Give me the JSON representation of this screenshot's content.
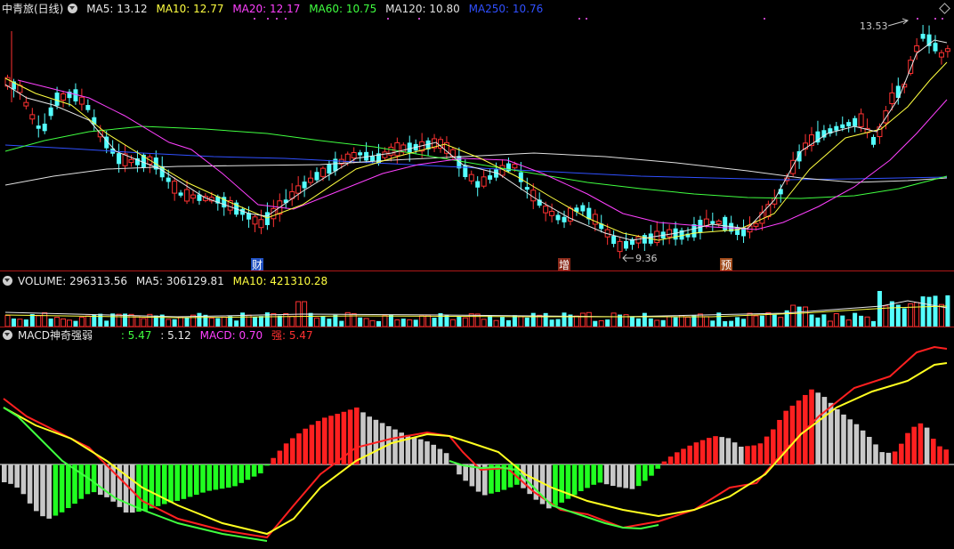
{
  "price_panel": {
    "title": "中青旅(日线)",
    "indicators": [
      {
        "name": "MA5",
        "value": "MA5: 13.12",
        "color": "#e8e8e8"
      },
      {
        "name": "MA10",
        "value": "MA10: 12.77",
        "color": "#ffff40"
      },
      {
        "name": "MA20",
        "value": "MA20: 12.17",
        "color": "#ff40ff"
      },
      {
        "name": "MA60",
        "value": "MA60: 10.75",
        "color": "#40ff40"
      },
      {
        "name": "MA120",
        "value": "MA120: 10.80",
        "color": "#e0e0e0"
      },
      {
        "name": "MA250",
        "value": "MA250: 10.76",
        "color": "#3050ff"
      }
    ],
    "high_label": "13.53",
    "low_label": "9.36",
    "event_markers": [
      {
        "label": "财",
        "color": "#2050c0"
      },
      {
        "label": "增",
        "color": "#8a2a1a"
      },
      {
        "label": "预",
        "color": "#a04a1a"
      }
    ]
  },
  "volume_panel": {
    "title": "VOLUME: 296313.56",
    "ma5": "MA5: 306129.81",
    "ma10": "MA10: 421310.28"
  },
  "macd_panel": {
    "title": "MACD神奇强弱",
    "v1": ": 5.47",
    "v2": ": 5.12",
    "macd": "MACD: 0.70",
    "strong": "强: 5.47"
  },
  "colors": {
    "up": "#ff3232",
    "down": "#54ffff",
    "ma5": "#e8e8e8",
    "ma10": "#ffff40",
    "ma20": "#ff40ff",
    "ma60": "#40ff40",
    "ma120": "#e0e0e0",
    "ma250": "#3050ff",
    "macd_pos": "#ff2020",
    "macd_neg": "#20ff20",
    "macd_fade": "#c8c8c8"
  }
}
